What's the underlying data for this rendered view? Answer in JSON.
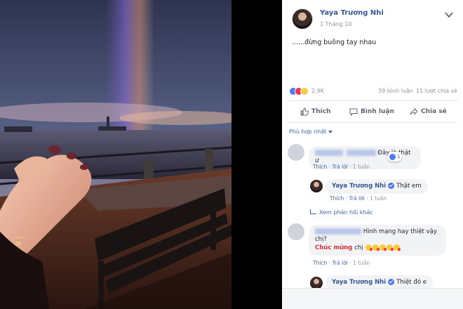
{
  "post": {
    "author": "Yaya Trương Nhi",
    "date": "1 Tháng 10",
    "text": "......đừng buông tay nhau"
  },
  "photo": {
    "film_date": "8| ˋ ˋ ˋ"
  },
  "stats": {
    "reactions": "2,9K",
    "comments": "39 bình luận",
    "shares": "11 lượt chia sẻ"
  },
  "actions": {
    "like": "Thích",
    "comment": "Bình luận",
    "share": "Chia sẻ"
  },
  "sort": {
    "label": "Phù hợp nhất"
  },
  "comments": [
    {
      "text": "Đây là thật ư",
      "reaction_count": "1",
      "meta": {
        "like": "Thích",
        "reply": "Trả lời",
        "time": "1 tuần"
      }
    },
    {
      "author": "Yaya Trương Nhi",
      "text": "Thật em",
      "meta": {
        "like": "Thích",
        "reply": "Trả lời",
        "time": "1 tuần"
      }
    },
    {
      "view_more": "Xem phản hồi khác"
    },
    {
      "text_1": "Hình mạng hay thiệt vậy",
      "text_2": "chị?",
      "congrats": "Chúc mừng",
      "text_3": "chị",
      "meta": {
        "like": "Thích",
        "reply": "Trả lời",
        "time": "1 tuần"
      }
    },
    {
      "author": "Yaya Trương Nhi",
      "text": "Thiệt đó e"
    }
  ],
  "colors": {
    "link": "#365899",
    "accent": "#4267b2",
    "muted": "#90949c",
    "congrats": "#e0303a"
  }
}
